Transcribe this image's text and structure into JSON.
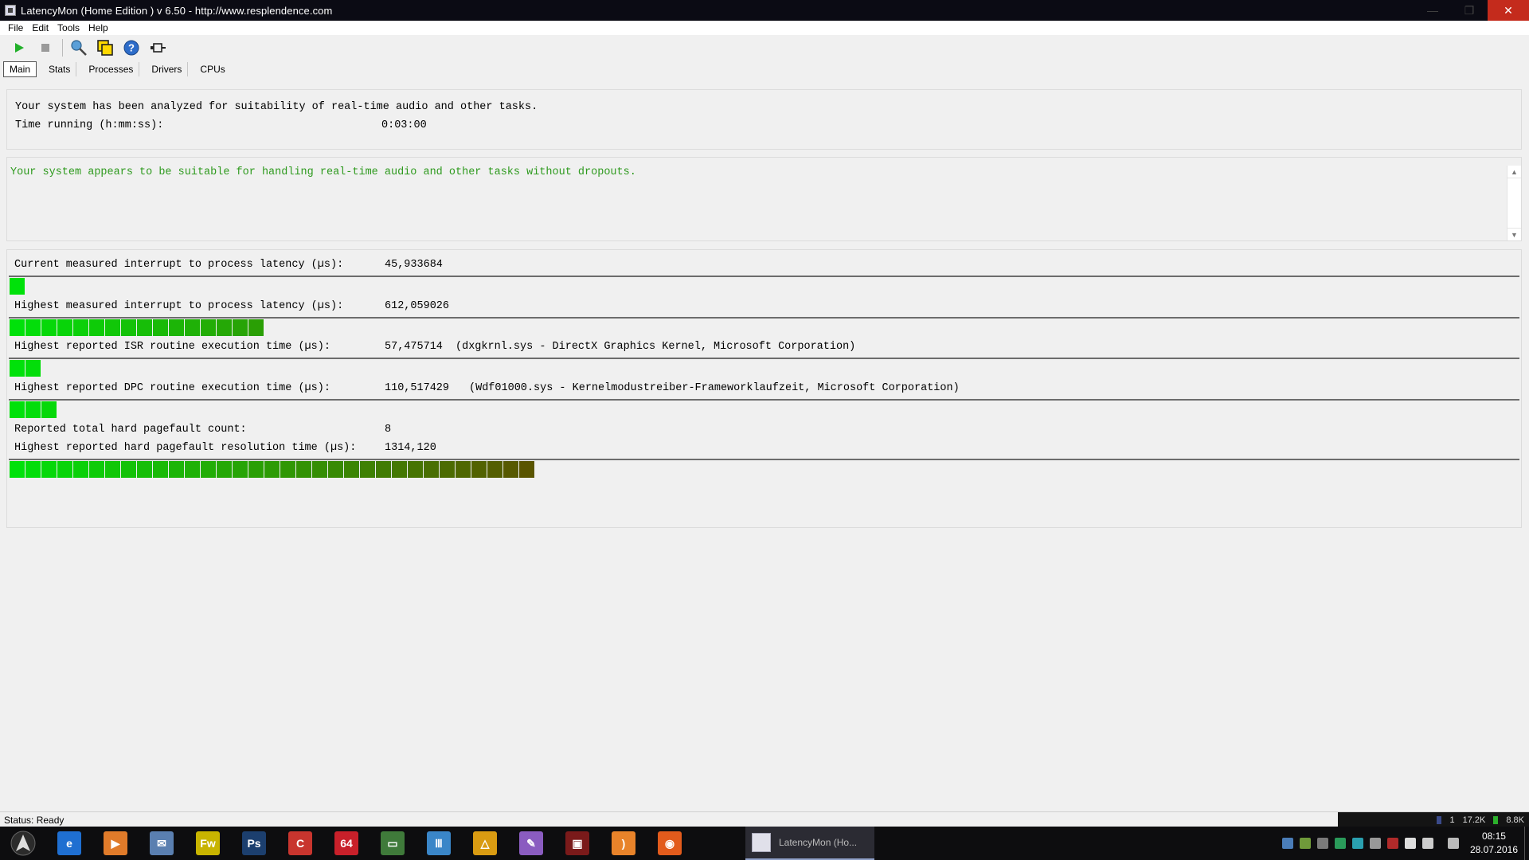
{
  "window": {
    "title": "LatencyMon  (Home Edition )  v 6.50 - http://www.resplendence.com",
    "minimize": "—",
    "maximize": "❐",
    "close": "✕"
  },
  "menu": {
    "items": [
      {
        "label": "File"
      },
      {
        "label": "Edit"
      },
      {
        "label": "Tools"
      },
      {
        "label": "Help"
      }
    ]
  },
  "toolbar": {
    "icons": [
      "play-icon",
      "stop-icon",
      "analyze-icon",
      "window-icon",
      "help-icon",
      "pin-icon"
    ]
  },
  "tabs": [
    {
      "label": "Main",
      "active": true
    },
    {
      "label": "Stats"
    },
    {
      "label": "Processes"
    },
    {
      "label": "Drivers"
    },
    {
      "label": "CPUs"
    }
  ],
  "summary": {
    "analyzed_text": "Your system has been analyzed for suitability of real-time audio and other tasks.",
    "time_label": "Time running (h:mm:ss):",
    "time_value": "0:03:00"
  },
  "verdict": {
    "text": "Your system appears to be suitable for handling real-time audio and other tasks without dropouts.",
    "color": "#2e9a1e"
  },
  "metrics": {
    "current_latency": {
      "label": "Current measured interrupt to process latency (µs):",
      "value": "45,933684",
      "segments": 1
    },
    "highest_latency": {
      "label": "Highest measured interrupt to process latency (µs):",
      "value": "612,059026",
      "segments": 16
    },
    "isr": {
      "label": "Highest reported ISR routine execution time (µs):",
      "value": "57,475714",
      "detail": "(dxgkrnl.sys - DirectX Graphics Kernel, Microsoft Corporation)",
      "segments": 2
    },
    "dpc": {
      "label": "Highest reported DPC routine execution time (µs):",
      "value": "110,517429",
      "detail": "(Wdf01000.sys - Kernelmodustreiber-Frameworklaufzeit, Microsoft Corporation)",
      "segments": 3
    },
    "pagefault_count": {
      "label": "Reported total hard pagefault count:",
      "value": "8"
    },
    "pagefault_time": {
      "label": "Highest reported hard pagefault resolution time (µs):",
      "value": "1314,120",
      "segments": 33
    }
  },
  "statusbar": {
    "status": "Status: Ready",
    "net_count": "1",
    "net_down": "17.2K",
    "net_up": "8.8K"
  },
  "taskbar": {
    "apps": [
      {
        "icon": "arch-start-icon",
        "color": "#1a1a1a",
        "text": ""
      },
      {
        "icon": "edge-icon",
        "color": "#1f6fd1",
        "text": "e"
      },
      {
        "icon": "media-player-icon",
        "color": "#e07b2a",
        "text": "▶"
      },
      {
        "icon": "thunderbird-icon",
        "color": "#5a7fb0",
        "text": "✉"
      },
      {
        "icon": "fireworks-icon",
        "color": "#c8b400",
        "text": "Fw"
      },
      {
        "icon": "photoshop-icon",
        "color": "#1c3f6e",
        "text": "Ps"
      },
      {
        "icon": "ccleaner-icon",
        "color": "#c8352e",
        "text": "C"
      },
      {
        "icon": "aida64-icon",
        "color": "#c8202a",
        "text": "64"
      },
      {
        "icon": "gpu-card-icon",
        "color": "#3f7a3a",
        "text": "▭"
      },
      {
        "icon": "equalizer-icon",
        "color": "#3a86c8",
        "text": "Ⅲ"
      },
      {
        "icon": "aimp-icon",
        "color": "#d99b12",
        "text": "△"
      },
      {
        "icon": "pencils-icon",
        "color": "#8a5cc0",
        "text": "✎"
      },
      {
        "icon": "gpu-z-icon",
        "color": "#7a1a1a",
        "text": "▣"
      },
      {
        "icon": "rss-icon",
        "color": "#e8832a",
        "text": ")"
      },
      {
        "icon": "firefox-icon",
        "color": "#e25b1c",
        "text": "◉"
      }
    ],
    "active_task": "LatencyMon  (Ho..."
  },
  "clock": {
    "time": "08:15",
    "date": "28.07.2016"
  }
}
